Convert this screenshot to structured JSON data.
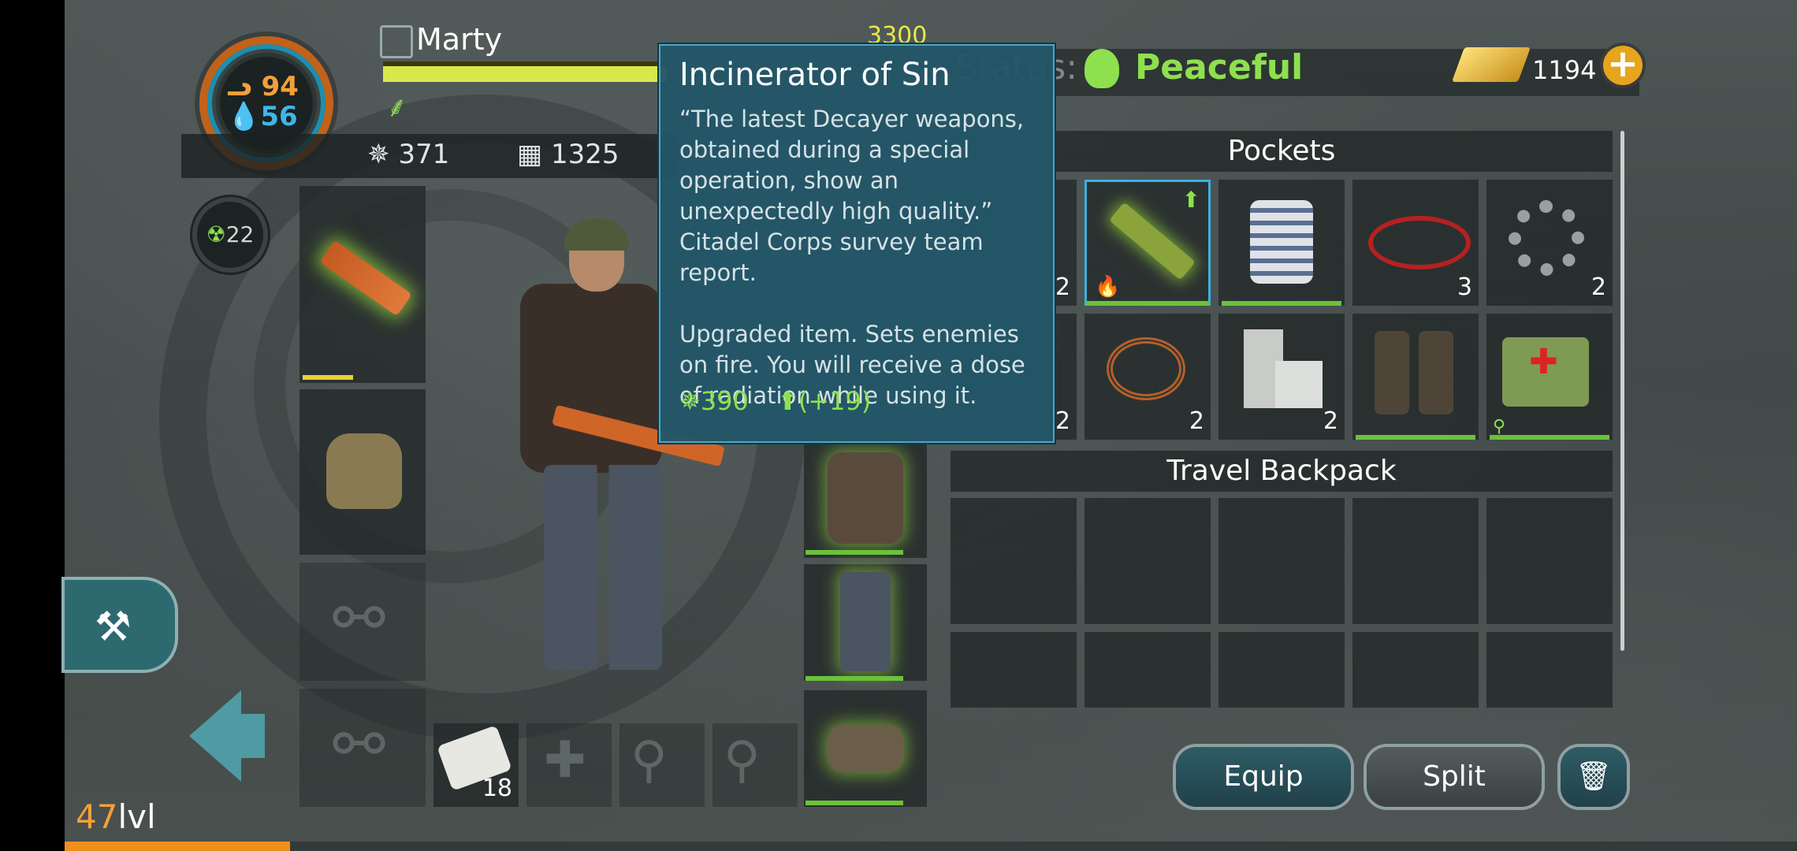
{
  "hud": {
    "food": "94",
    "water": "56",
    "radiation": "22",
    "player_name": "Marty",
    "xp_value": "3300",
    "attack": "371",
    "armor": "1325",
    "status_label": "Status:",
    "status_value": "Peaceful",
    "gold": "1194",
    "level_number": "47",
    "level_label": "lvl",
    "level_progress": 0.13
  },
  "tooltip": {
    "title": "Incinerator of Sin",
    "description": "“The latest Decayer weapons, obtained during a special operation, show an unexpectedly high quality.” Citadel Corps survey team report.",
    "effect": "Upgraded item. Sets enemies on fire. You will receive a dose of radiation while using it.",
    "damage": "390",
    "damage_delta": "(+19)"
  },
  "inventory": {
    "pockets_title": "Pockets",
    "backpack_title": "Travel Backpack",
    "pocket_items": [
      {
        "name": "incinerator-of-sin",
        "qty": "",
        "selected": true
      },
      {
        "name": "striped-shirt",
        "qty": ""
      },
      {
        "name": "wires",
        "qty": "3"
      },
      {
        "name": "gear",
        "qty": "2"
      },
      {
        "name": "copper-wire",
        "qty": "2"
      },
      {
        "name": "concrete-blocks",
        "qty": "2"
      },
      {
        "name": "boots",
        "qty": ""
      },
      {
        "name": "medkit-case",
        "qty": ""
      }
    ],
    "hidden_left_qty_1": "2",
    "hidden_left_qty_2": "2",
    "bandage_qty": "18"
  },
  "buttons": {
    "equip": "Equip",
    "split": "Split"
  },
  "colors": {
    "accent_green": "#8ee04e",
    "gold": "#e6a51c",
    "tooltip_bg": "#225668",
    "level_orange": "#ef8f1e"
  }
}
